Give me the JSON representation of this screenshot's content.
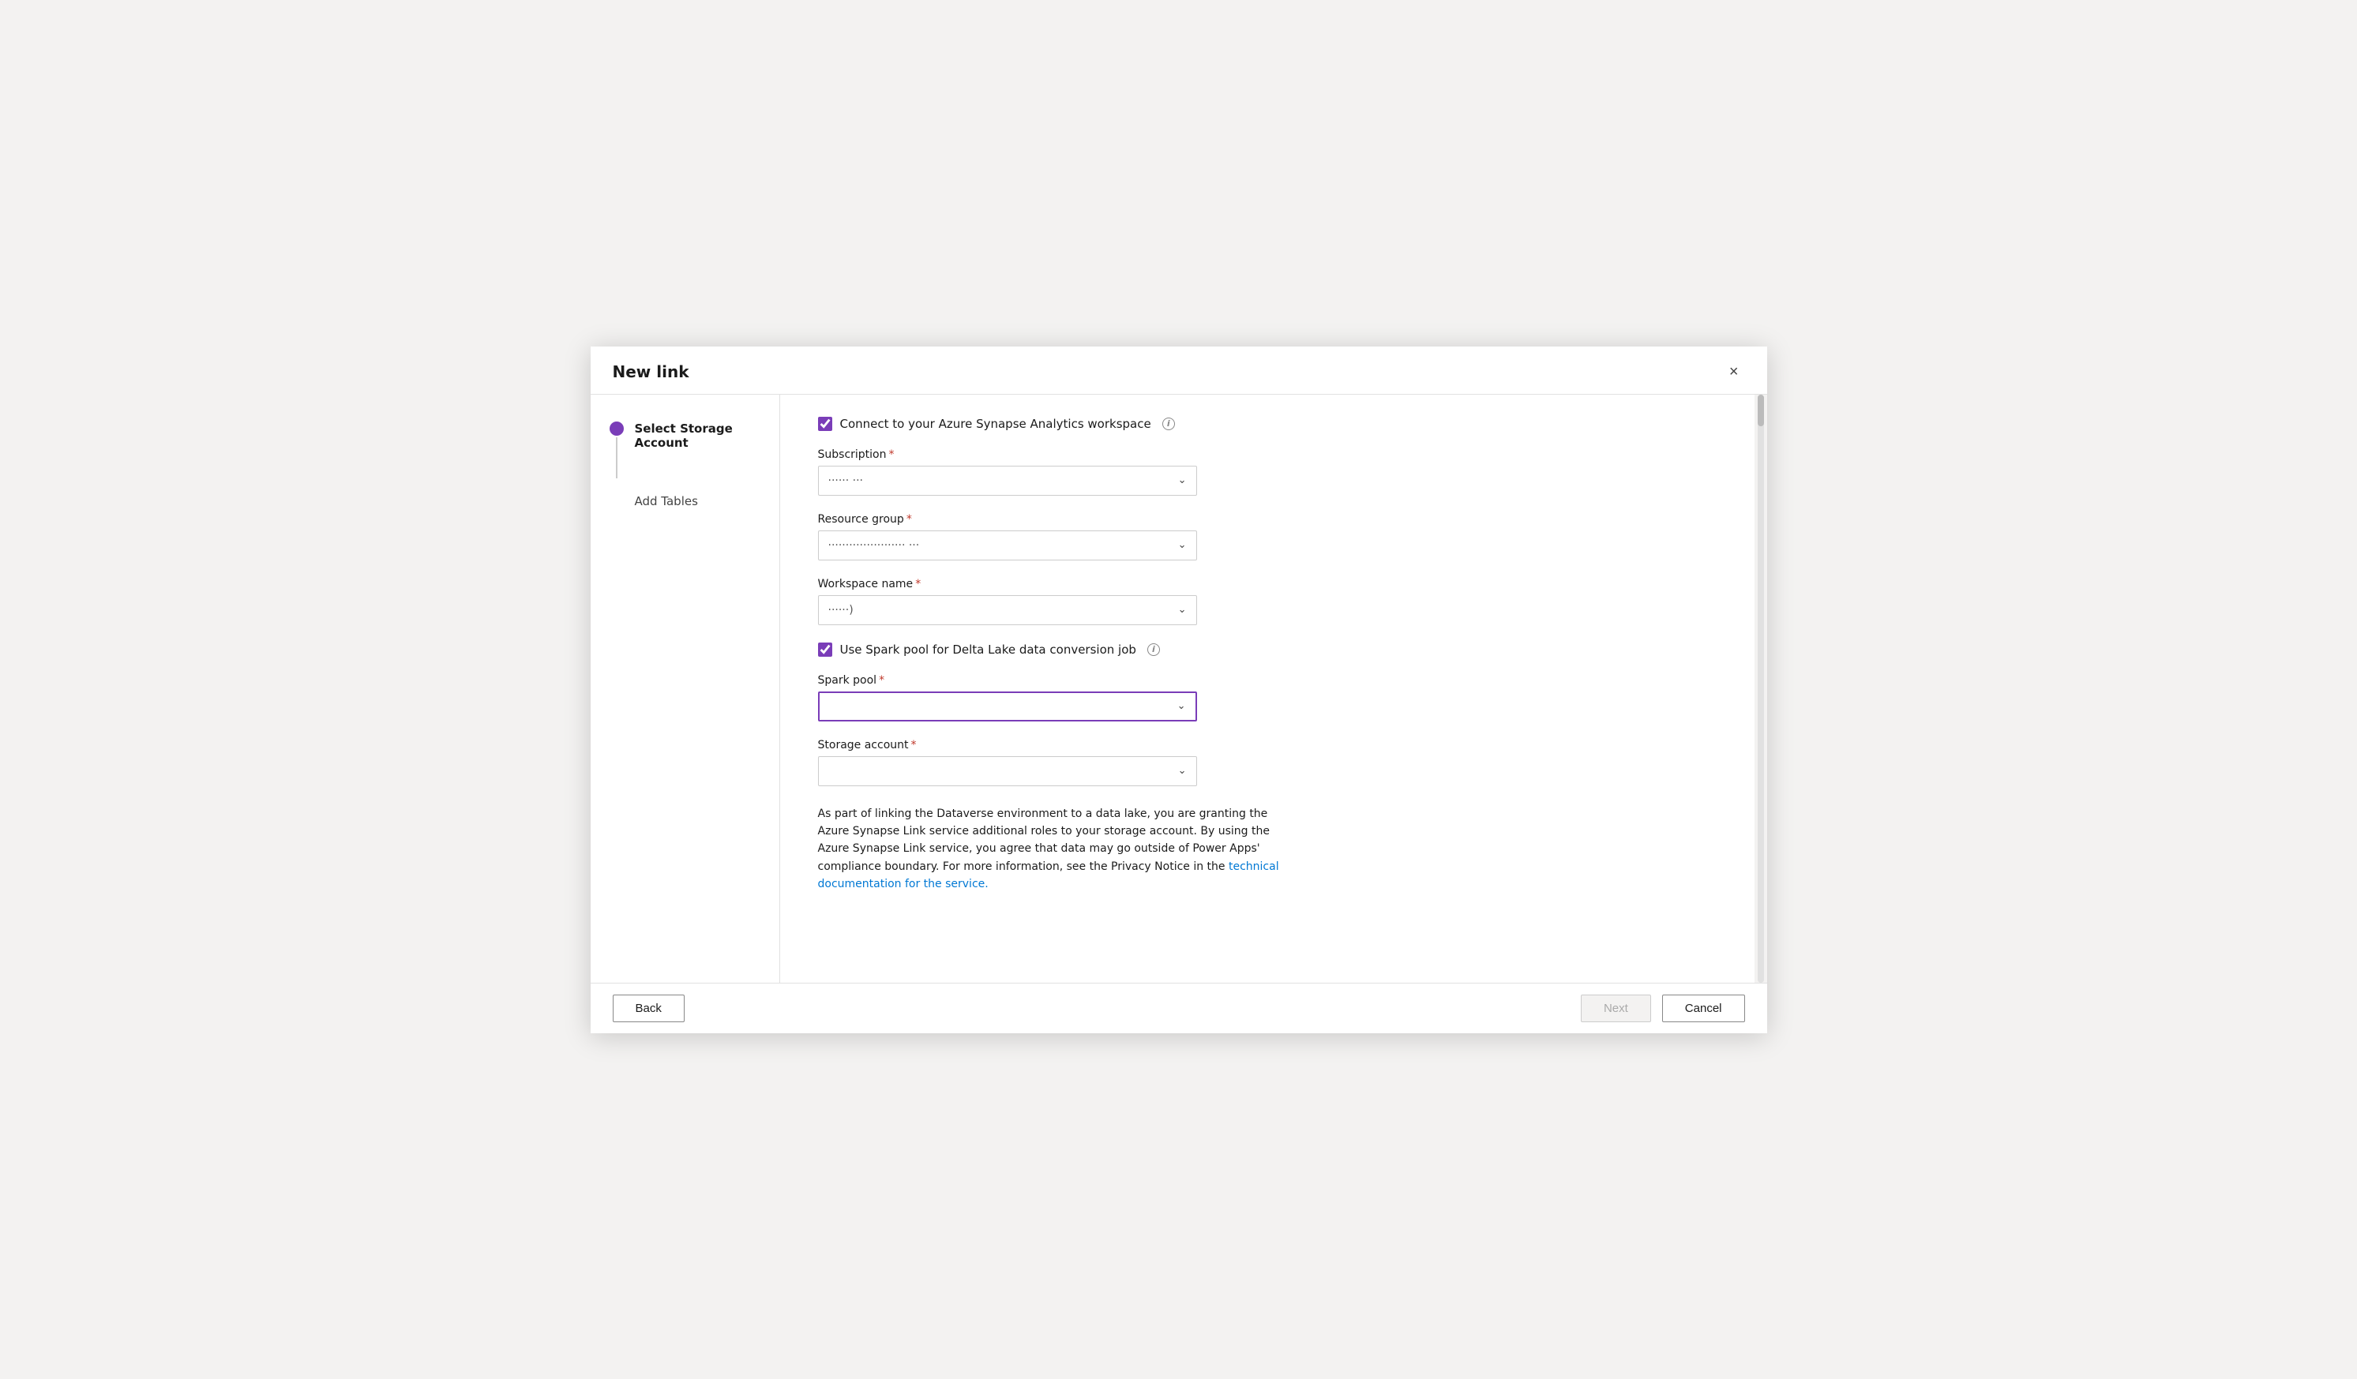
{
  "dialog": {
    "title": "New link",
    "close_label": "×"
  },
  "sidebar": {
    "steps": [
      {
        "id": "select-storage-account",
        "label": "Select Storage Account",
        "active": true
      },
      {
        "id": "add-tables",
        "label": "Add Tables",
        "active": false
      }
    ]
  },
  "form": {
    "connect_checkbox_label": "Connect to your Azure Synapse Analytics workspace",
    "connect_checked": true,
    "fields": [
      {
        "id": "subscription",
        "label": "Subscription",
        "required": true,
        "value": "······ ···",
        "placeholder": ""
      },
      {
        "id": "resource_group",
        "label": "Resource group",
        "required": true,
        "value": "······················ ···",
        "placeholder": ""
      },
      {
        "id": "workspace_name",
        "label": "Workspace name",
        "required": true,
        "value": "······)",
        "placeholder": ""
      }
    ],
    "spark_checkbox_label": "Use Spark pool for Delta Lake data conversion job",
    "spark_checked": true,
    "spark_pool_label": "Spark pool",
    "spark_pool_required": true,
    "spark_pool_value": "",
    "spark_pool_focused": true,
    "storage_account_label": "Storage account",
    "storage_account_required": true,
    "storage_account_value": "",
    "info_text_part1": "As part of linking the Dataverse environment to a data lake, you are granting the Azure Synapse Link service additional roles to your storage account. By using the Azure Synapse Link service, you agree that data may go outside of Power Apps' compliance boundary. For more information, see the Privacy Notice in the ",
    "info_link_label": "technical documentation for the service.",
    "info_link_href": "#"
  },
  "footer": {
    "back_label": "Back",
    "next_label": "Next",
    "cancel_label": "Cancel"
  },
  "icons": {
    "info": "i",
    "chevron_down": "⌄",
    "close": "✕",
    "checkbox_checked": "☑",
    "checkbox_unchecked": "☐"
  }
}
